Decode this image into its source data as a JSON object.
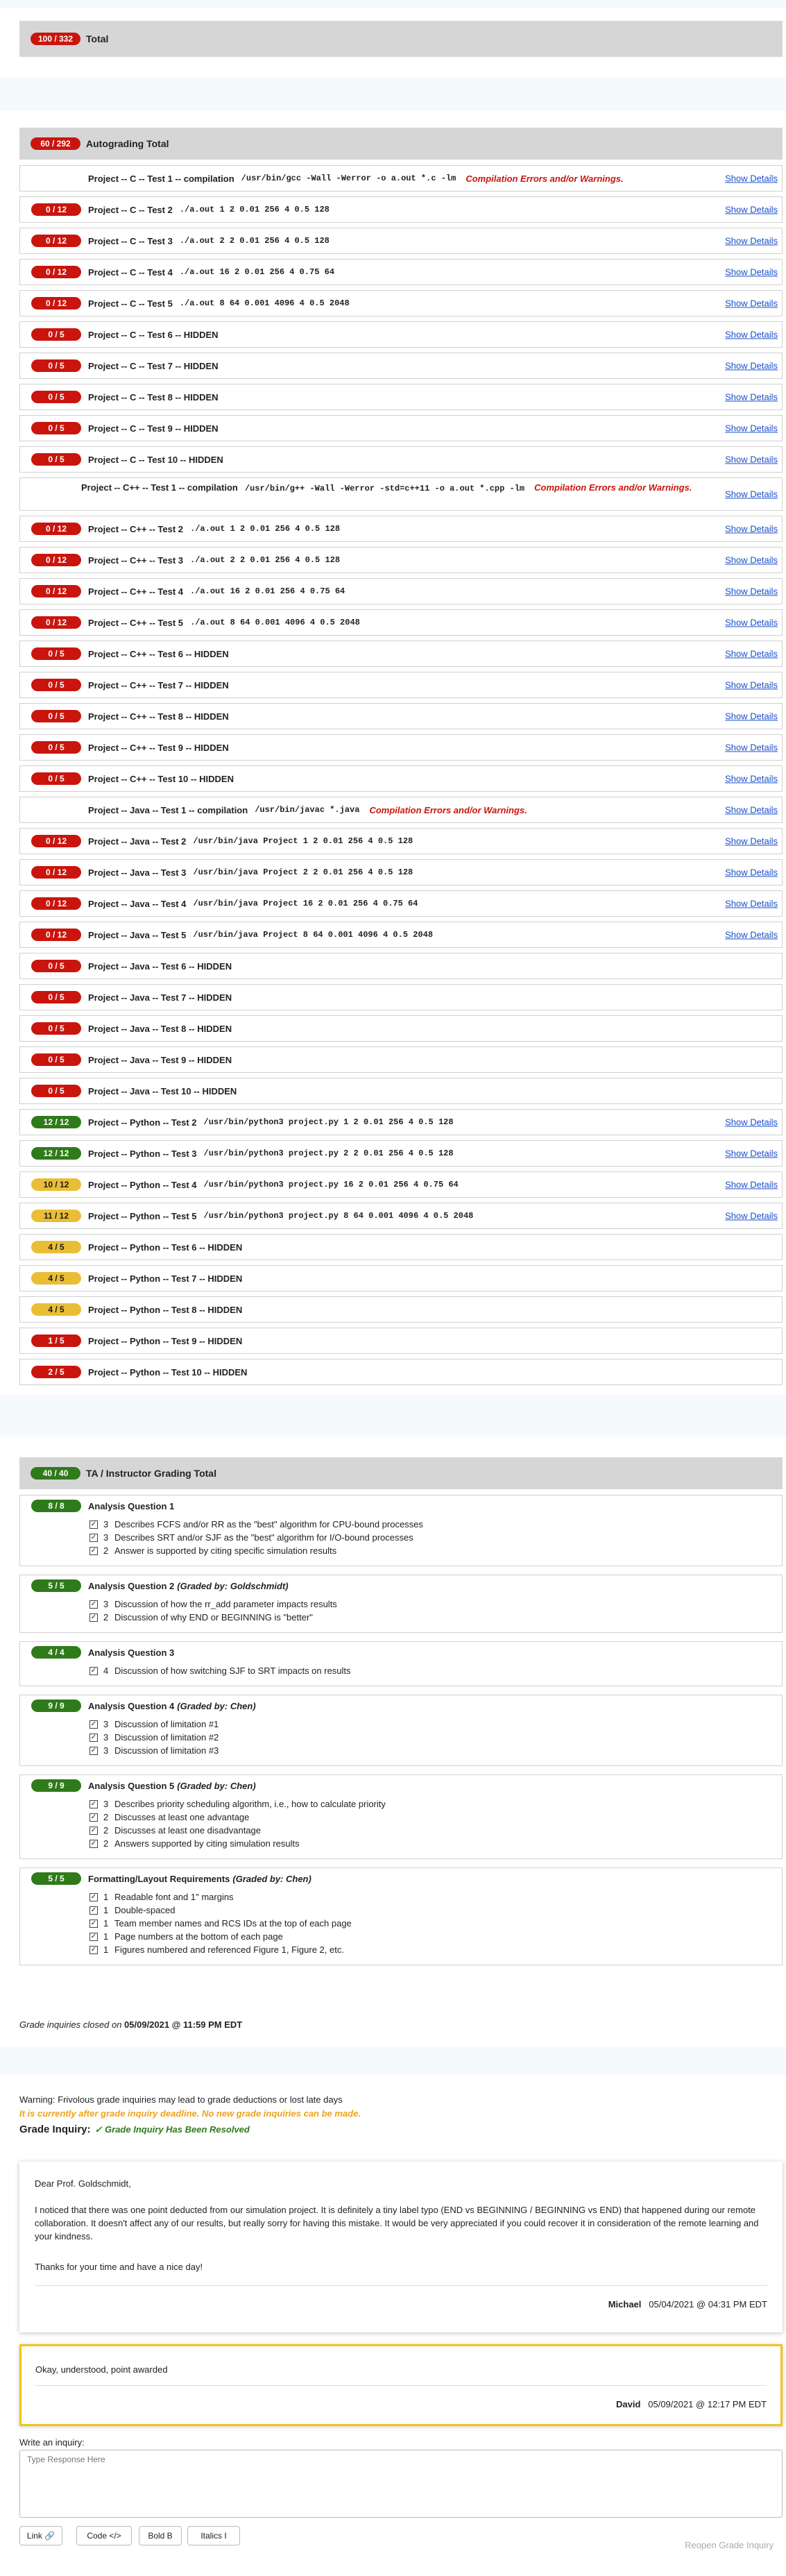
{
  "total": {
    "badge": "100 / 332",
    "label": "Total"
  },
  "autograding": {
    "badge": "60 / 292",
    "label": "Autograding Total"
  },
  "show_details": "Show Details",
  "tests": [
    {
      "badge": "",
      "color": "",
      "label": "Project -- C -- Test 1 -- compilation",
      "cmd": "/usr/bin/gcc -Wall -Werror -o a.out *.c -lm",
      "warn": "Compilation Errors and/or Warnings.",
      "details": true
    },
    {
      "badge": "0 / 12",
      "color": "red",
      "label": "Project -- C -- Test 2",
      "cmd": "./a.out 1 2 0.01 256 4 0.5 128",
      "warn": "",
      "details": true
    },
    {
      "badge": "0 / 12",
      "color": "red",
      "label": "Project -- C -- Test 3",
      "cmd": "./a.out 2 2 0.01 256 4 0.5 128",
      "warn": "",
      "details": true
    },
    {
      "badge": "0 / 12",
      "color": "red",
      "label": "Project -- C -- Test 4",
      "cmd": "./a.out 16 2 0.01 256 4 0.75 64",
      "warn": "",
      "details": true
    },
    {
      "badge": "0 / 12",
      "color": "red",
      "label": "Project -- C -- Test 5",
      "cmd": "./a.out 8 64 0.001 4096 4 0.5 2048",
      "warn": "",
      "details": true
    },
    {
      "badge": "0 / 5",
      "color": "red",
      "label": "Project -- C -- Test 6 -- HIDDEN",
      "cmd": "",
      "warn": "",
      "details": true
    },
    {
      "badge": "0 / 5",
      "color": "red",
      "label": "Project -- C -- Test 7 -- HIDDEN",
      "cmd": "",
      "warn": "",
      "details": true
    },
    {
      "badge": "0 / 5",
      "color": "red",
      "label": "Project -- C -- Test 8 -- HIDDEN",
      "cmd": "",
      "warn": "",
      "details": true
    },
    {
      "badge": "0 / 5",
      "color": "red",
      "label": "Project -- C -- Test 9 -- HIDDEN",
      "cmd": "",
      "warn": "",
      "details": true
    },
    {
      "badge": "0 / 5",
      "color": "red",
      "label": "Project -- C -- Test 10 -- HIDDEN",
      "cmd": "",
      "warn": "",
      "details": true
    },
    {
      "badge": "",
      "color": "",
      "label": "Project -- C++ -- Test 1 -- compilation",
      "cmd": "/usr/bin/g++ -Wall -Werror -std=c++11 -o a.out *.cpp -lm",
      "warn": "Compilation Errors and/or Warnings.",
      "details": true,
      "wrap": true
    },
    {
      "badge": "0 / 12",
      "color": "red",
      "label": "Project -- C++ -- Test 2",
      "cmd": "./a.out 1 2 0.01 256 4 0.5 128",
      "warn": "",
      "details": true
    },
    {
      "badge": "0 / 12",
      "color": "red",
      "label": "Project -- C++ -- Test 3",
      "cmd": "./a.out 2 2 0.01 256 4 0.5 128",
      "warn": "",
      "details": true
    },
    {
      "badge": "0 / 12",
      "color": "red",
      "label": "Project -- C++ -- Test 4",
      "cmd": "./a.out 16 2 0.01 256 4 0.75 64",
      "warn": "",
      "details": true
    },
    {
      "badge": "0 / 12",
      "color": "red",
      "label": "Project -- C++ -- Test 5",
      "cmd": "./a.out 8 64 0.001 4096 4 0.5 2048",
      "warn": "",
      "details": true
    },
    {
      "badge": "0 / 5",
      "color": "red",
      "label": "Project -- C++ -- Test 6 -- HIDDEN",
      "cmd": "",
      "warn": "",
      "details": true
    },
    {
      "badge": "0 / 5",
      "color": "red",
      "label": "Project -- C++ -- Test 7 -- HIDDEN",
      "cmd": "",
      "warn": "",
      "details": true
    },
    {
      "badge": "0 / 5",
      "color": "red",
      "label": "Project -- C++ -- Test 8 -- HIDDEN",
      "cmd": "",
      "warn": "",
      "details": true
    },
    {
      "badge": "0 / 5",
      "color": "red",
      "label": "Project -- C++ -- Test 9 -- HIDDEN",
      "cmd": "",
      "warn": "",
      "details": true
    },
    {
      "badge": "0 / 5",
      "color": "red",
      "label": "Project -- C++ -- Test 10 -- HIDDEN",
      "cmd": "",
      "warn": "",
      "details": true
    },
    {
      "badge": "",
      "color": "",
      "label": "Project -- Java -- Test 1 -- compilation",
      "cmd": "/usr/bin/javac *.java",
      "warn": "Compilation Errors and/or Warnings.",
      "details": true
    },
    {
      "badge": "0 / 12",
      "color": "red",
      "label": "Project -- Java -- Test 2",
      "cmd": "/usr/bin/java Project 1 2 0.01 256 4 0.5 128",
      "warn": "",
      "details": true
    },
    {
      "badge": "0 / 12",
      "color": "red",
      "label": "Project -- Java -- Test 3",
      "cmd": "/usr/bin/java Project 2 2 0.01 256 4 0.5 128",
      "warn": "",
      "details": true
    },
    {
      "badge": "0 / 12",
      "color": "red",
      "label": "Project -- Java -- Test 4",
      "cmd": "/usr/bin/java Project 16 2 0.01 256 4 0.75 64",
      "warn": "",
      "details": true
    },
    {
      "badge": "0 / 12",
      "color": "red",
      "label": "Project -- Java -- Test 5",
      "cmd": "/usr/bin/java Project 8 64 0.001 4096 4 0.5 2048",
      "warn": "",
      "details": true
    },
    {
      "badge": "0 / 5",
      "color": "red",
      "label": "Project -- Java -- Test 6 -- HIDDEN",
      "cmd": "",
      "warn": "",
      "details": false
    },
    {
      "badge": "0 / 5",
      "color": "red",
      "label": "Project -- Java -- Test 7 -- HIDDEN",
      "cmd": "",
      "warn": "",
      "details": false
    },
    {
      "badge": "0 / 5",
      "color": "red",
      "label": "Project -- Java -- Test 8 -- HIDDEN",
      "cmd": "",
      "warn": "",
      "details": false
    },
    {
      "badge": "0 / 5",
      "color": "red",
      "label": "Project -- Java -- Test 9 -- HIDDEN",
      "cmd": "",
      "warn": "",
      "details": false
    },
    {
      "badge": "0 / 5",
      "color": "red",
      "label": "Project -- Java -- Test 10 -- HIDDEN",
      "cmd": "",
      "warn": "",
      "details": false
    },
    {
      "badge": "12 / 12",
      "color": "green",
      "label": "Project -- Python -- Test 2",
      "cmd": "/usr/bin/python3 project.py 1 2 0.01 256 4 0.5 128",
      "warn": "",
      "details": true
    },
    {
      "badge": "12 / 12",
      "color": "green",
      "label": "Project -- Python -- Test 3",
      "cmd": "/usr/bin/python3 project.py 2 2 0.01 256 4 0.5 128",
      "warn": "",
      "details": true
    },
    {
      "badge": "10 / 12",
      "color": "yellow",
      "label": "Project -- Python -- Test 4",
      "cmd": "/usr/bin/python3 project.py 16 2 0.01 256 4 0.75 64",
      "warn": "",
      "details": true
    },
    {
      "badge": "11 / 12",
      "color": "yellow",
      "label": "Project -- Python -- Test 5",
      "cmd": "/usr/bin/python3 project.py 8 64 0.001 4096 4 0.5 2048",
      "warn": "",
      "details": true
    },
    {
      "badge": "4 / 5",
      "color": "yellow",
      "label": "Project -- Python -- Test 6 -- HIDDEN",
      "cmd": "",
      "warn": "",
      "details": false
    },
    {
      "badge": "4 / 5",
      "color": "yellow",
      "label": "Project -- Python -- Test 7 -- HIDDEN",
      "cmd": "",
      "warn": "",
      "details": false
    },
    {
      "badge": "4 / 5",
      "color": "yellow",
      "label": "Project -- Python -- Test 8 -- HIDDEN",
      "cmd": "",
      "warn": "",
      "details": false
    },
    {
      "badge": "1 / 5",
      "color": "red",
      "label": "Project -- Python -- Test 9 -- HIDDEN",
      "cmd": "",
      "warn": "",
      "details": false
    },
    {
      "badge": "2 / 5",
      "color": "red",
      "label": "Project -- Python -- Test 10 -- HIDDEN",
      "cmd": "",
      "warn": "",
      "details": false
    }
  ],
  "ta_total": {
    "badge": "40 / 40",
    "label": "TA / Instructor Grading Total"
  },
  "questions": [
    {
      "badge": "8 / 8",
      "title": "Analysis Question 1",
      "grader": "",
      "items": [
        [
          "3",
          "Describes FCFS and/or RR as the \"best\" algorithm for CPU-bound processes"
        ],
        [
          "3",
          "Describes SRT and/or SJF as the \"best\" algorithm for I/O-bound processes"
        ],
        [
          "2",
          "Answer is supported by citing specific simulation results"
        ]
      ]
    },
    {
      "badge": "5 / 5",
      "title": "Analysis Question 2",
      "grader": "(Graded by: Goldschmidt)",
      "items": [
        [
          "3",
          "Discussion of how the rr_add parameter impacts results"
        ],
        [
          "2",
          "Discussion of why END or BEGINNING is \"better\""
        ]
      ]
    },
    {
      "badge": "4 / 4",
      "title": "Analysis Question 3",
      "grader": "",
      "items": [
        [
          "4",
          "Discussion of how switching SJF to SRT impacts on results"
        ]
      ]
    },
    {
      "badge": "9 / 9",
      "title": "Analysis Question 4",
      "grader": "(Graded by: Chen)",
      "items": [
        [
          "3",
          "Discussion of limitation #1"
        ],
        [
          "3",
          "Discussion of limitation #2"
        ],
        [
          "3",
          "Discussion of limitation #3"
        ]
      ]
    },
    {
      "badge": "9 / 9",
      "title": "Analysis Question 5",
      "grader": "(Graded by: Chen)",
      "items": [
        [
          "3",
          "Describes priority scheduling algorithm, i.e., how to calculate priority"
        ],
        [
          "2",
          "Discusses at least one advantage"
        ],
        [
          "2",
          "Discusses at least one disadvantage"
        ],
        [
          "2",
          "Answers supported by citing simulation results"
        ]
      ]
    },
    {
      "badge": "5 / 5",
      "title": "Formatting/Layout Requirements",
      "grader": "(Graded by: Chen)",
      "items": [
        [
          "1",
          "Readable font and 1\" margins"
        ],
        [
          "1",
          "Double-spaced"
        ],
        [
          "1",
          "Team member names and RCS IDs at the top of each page"
        ],
        [
          "1",
          "Page numbers at the bottom of each page"
        ],
        [
          "1",
          "Figures numbered and referenced Figure 1, Figure 2, etc."
        ]
      ]
    }
  ],
  "closed": {
    "prefix": "Grade inquiries closed on ",
    "date": "05/09/2021 @ 11:59 PM EDT"
  },
  "warning": "Warning: Frivolous grade inquiries may lead to grade deductions or lost late days",
  "deadline": "It is currently after grade inquiry deadline. No new grade inquiries can be made.",
  "inquiry": {
    "title": "Grade Inquiry:",
    "resolved": "✓ Grade Inquiry Has Been Resolved"
  },
  "post1": {
    "greeting": "Dear Prof. Goldschmidt,",
    "body": "I noticed that there was one point deducted from our simulation project. It is definitely a tiny label typo (END vs BEGINNING / BEGINNING vs END) that happened during our remote collaboration. It doesn't affect any of our results, but really sorry for having this mistake. It would be very appreciated if you could recover it in consideration of the remote learning and your kindness.",
    "thanks": "Thanks for your time and have a nice day!",
    "author": "Michael",
    "time": "05/04/2021 @ 04:31 PM EDT"
  },
  "post2": {
    "body": "Okay, understood, point awarded",
    "author": "David",
    "time": "05/09/2021 @ 12:17 PM EDT"
  },
  "write": {
    "label": "Write an inquiry:",
    "placeholder": "Type Response Here"
  },
  "buttons": {
    "link": "Link 🔗",
    "code": "Code </>",
    "bold": "Bold B",
    "italic": "Italics I",
    "reopen": "Reopen Grade Inquiry"
  },
  "colors": {
    "red": "#c9150e",
    "green": "#2f7a1a",
    "yellow": "#e9be36",
    "link": "#1a4fc9",
    "highlight": "#f2c31a"
  }
}
